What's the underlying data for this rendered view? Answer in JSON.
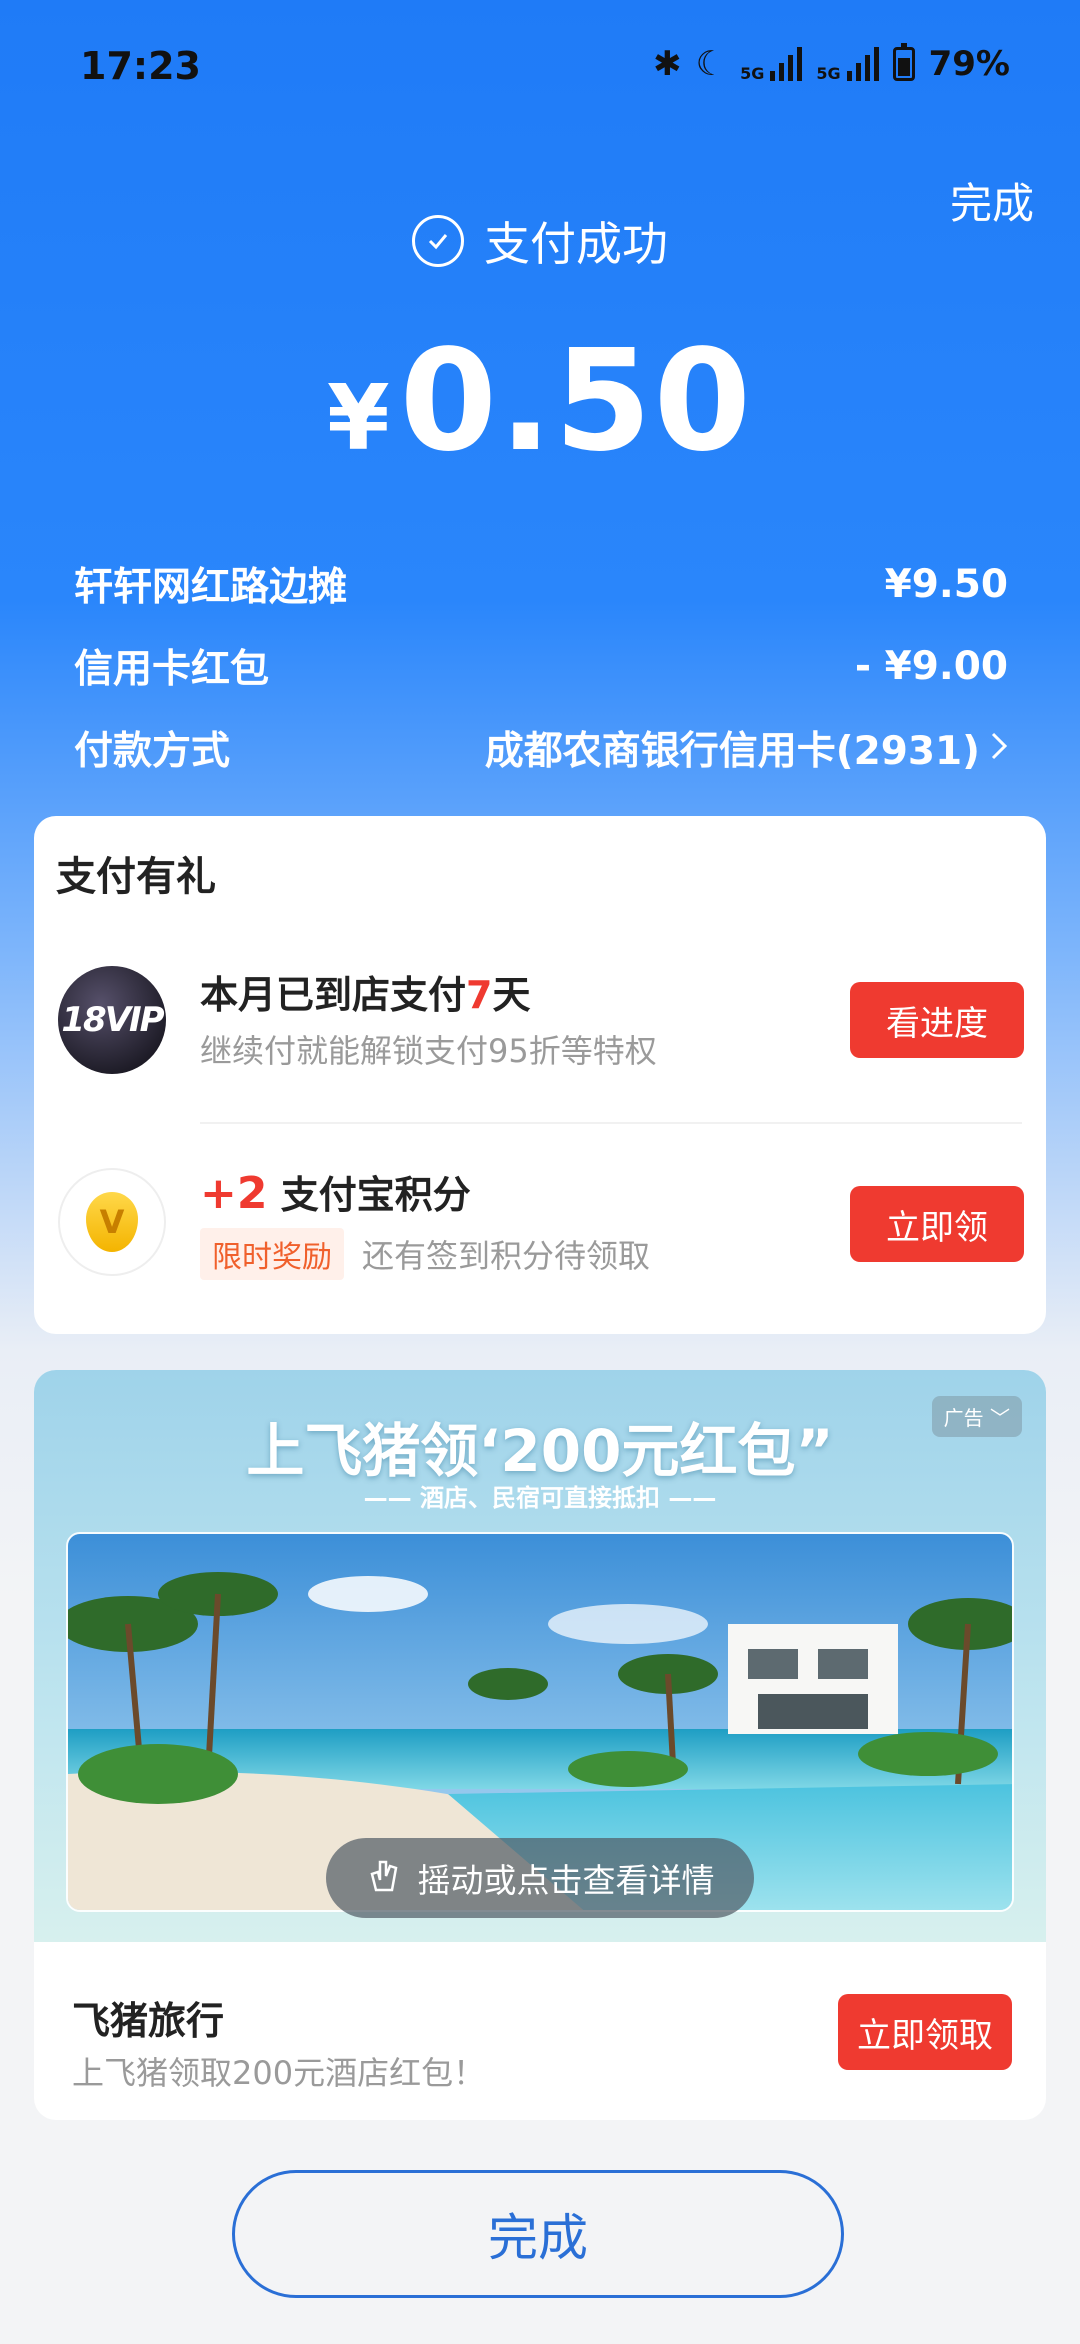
{
  "status_bar": {
    "time": "17:23",
    "network1": "5G",
    "network2": "5G",
    "battery": "79%"
  },
  "header": {
    "done_label": "完成",
    "success_text": "支付成功",
    "currency": "¥",
    "amount": "0.50"
  },
  "details": [
    {
      "label": "轩轩网红路边摊",
      "value": "¥9.50"
    },
    {
      "label": "信用卡红包",
      "value": "- ¥9.00"
    },
    {
      "label": "付款方式",
      "value": "成都农商银行信用卡(2931)"
    }
  ],
  "rewards": {
    "title": "支付有礼",
    "vip": {
      "badge": "18VIP",
      "title_prefix": "本月已到店支付",
      "title_num": "7",
      "title_suffix": "天",
      "subtitle": "继续付就能解锁支付95折等特权",
      "button": "看进度"
    },
    "points": {
      "title_num": "+2",
      "title_text": "支付宝积分",
      "tag": "限时奖励",
      "subtitle": "还有签到积分待领取",
      "button": "立即领"
    }
  },
  "ad": {
    "headline": "上飞猪领‘200元红包”",
    "subline": "—— 酒店、民宿可直接抵扣 ——",
    "ad_label": "广告",
    "shake_text": "摇动或点击查看详情",
    "brand": "飞猪旅行",
    "desc": "上飞猪领取200元酒店红包！",
    "button": "立即领取"
  },
  "footer": {
    "done_label": "完成"
  },
  "colors": {
    "primary_blue": "#1f7bf7",
    "accent_red": "#ef3a30",
    "outline_blue": "#2a6fd6"
  }
}
